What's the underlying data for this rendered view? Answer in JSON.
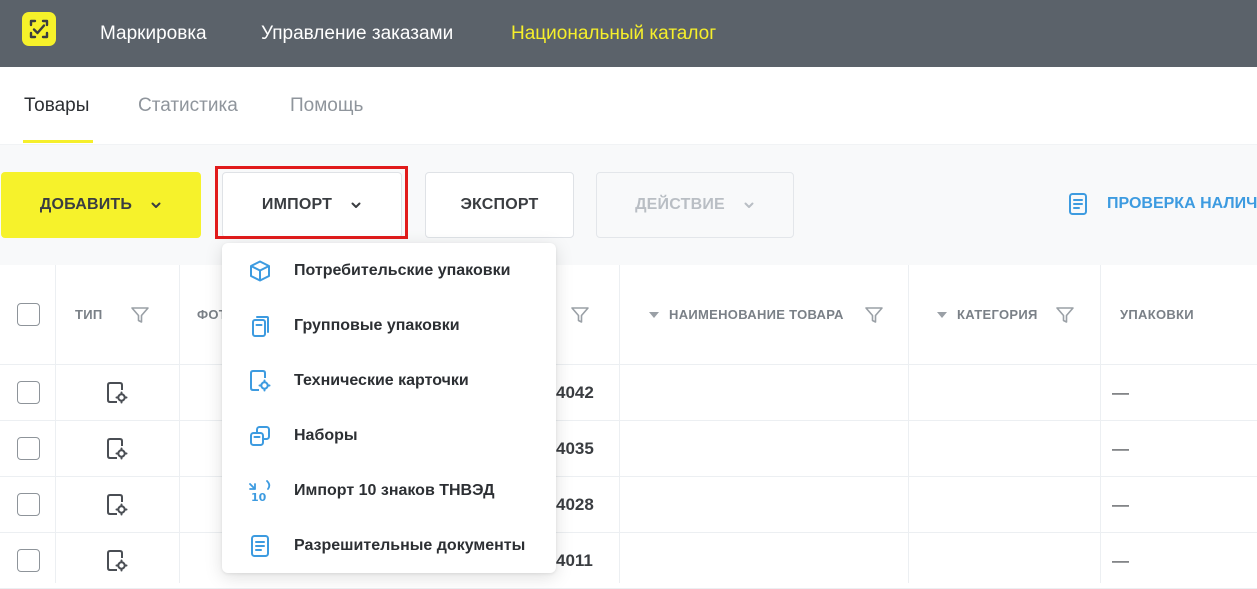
{
  "topbar": {
    "logo_icon": "check-frame-icon",
    "nav": [
      "Маркировка",
      "Управление заказами",
      "Национальный каталог"
    ],
    "active_nav": "Национальный каталог",
    "accent": "#f6ef2b",
    "background": "#5b626a"
  },
  "tabs": {
    "items": [
      "Товары",
      "Статистика",
      "Помощь"
    ],
    "active": "Товары"
  },
  "toolbar": {
    "add_label": "ДОБАВИТЬ",
    "import_label": "ИМПОРТ",
    "export_label": "ЭКСПОРТ",
    "action_label": "ДЕЙСТВИЕ",
    "check_label": "ПРОВЕРКА НАЛИЧ"
  },
  "table": {
    "headers": {
      "type": "ТИП",
      "photo": "ФОТ",
      "name": "НАИМЕНОВАНИЕ ТОВАРА",
      "category": "КАТЕГОРИЯ",
      "packages": "УПАКОВКИ"
    },
    "rows": [
      {
        "id": "4042",
        "packages": "—"
      },
      {
        "id": "4035",
        "packages": "—"
      },
      {
        "id": "4028",
        "packages": "—"
      },
      {
        "id": "4011",
        "packages": "—"
      }
    ]
  },
  "import_menu": {
    "items": [
      {
        "label": "Потребительские упаковки",
        "icon": "cube-icon"
      },
      {
        "label": "Групповые упаковки",
        "icon": "group-package-icon"
      },
      {
        "label": "Технические карточки",
        "icon": "tech-card-icon"
      },
      {
        "label": "Наборы",
        "icon": "set-icon"
      },
      {
        "label": "Импорт 10 знаков ТНВЭД",
        "icon": "tnved-10-icon"
      },
      {
        "label": "Разрешительные документы",
        "icon": "document-icon"
      }
    ]
  }
}
